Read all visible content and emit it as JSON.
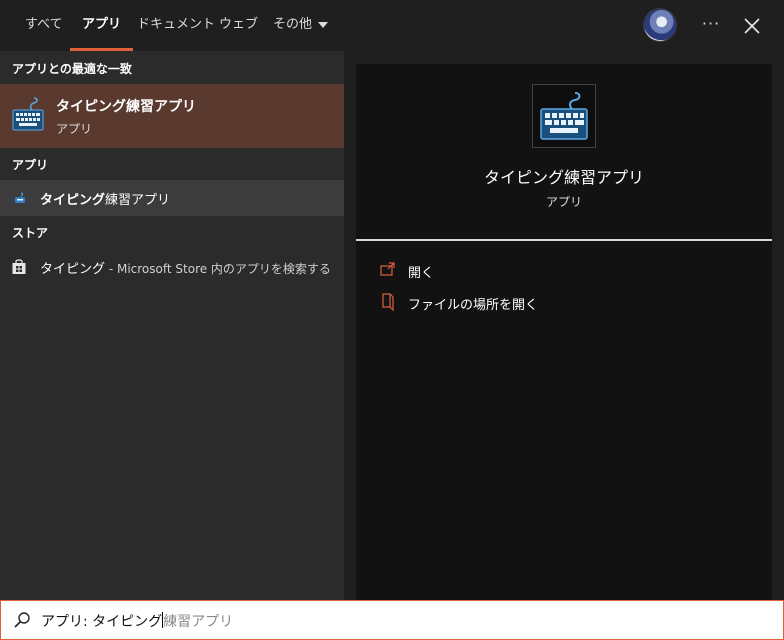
{
  "tabs": {
    "all": "すべて",
    "apps": "アプリ",
    "documents": "ドキュメント",
    "web": "ウェブ",
    "more": "その他"
  },
  "left": {
    "best_match_header": "アプリとの最適な一致",
    "best_match_title": "タイピング練習アプリ",
    "best_match_type": "アプリ",
    "apps_header": "アプリ",
    "app_item_bold": "タイピング",
    "app_item_rest": "練習アプリ",
    "store_header": "ストア",
    "store_item_bold": "タイピング",
    "store_item_suffix": " - Microsoft Store 内のアプリを検索する"
  },
  "right": {
    "app_name": "タイピング練習アプリ",
    "app_type": "アプリ",
    "actions": [
      "開く",
      "ファイルの場所を開く"
    ]
  },
  "search": {
    "typed": "アプリ: タイピング",
    "suggestion": "練習アプリ"
  },
  "colors": {
    "accent": "#e0603c",
    "best_match_bg": "#5a3a2f",
    "selected_row_bg": "#3c3c3c",
    "panel_left": "#2b2b2b",
    "panel_right": "#121212"
  },
  "icons": [
    "keyboard-icon",
    "store-icon",
    "open-icon",
    "file-location-icon",
    "search-icon",
    "close-icon",
    "more-icon"
  ]
}
